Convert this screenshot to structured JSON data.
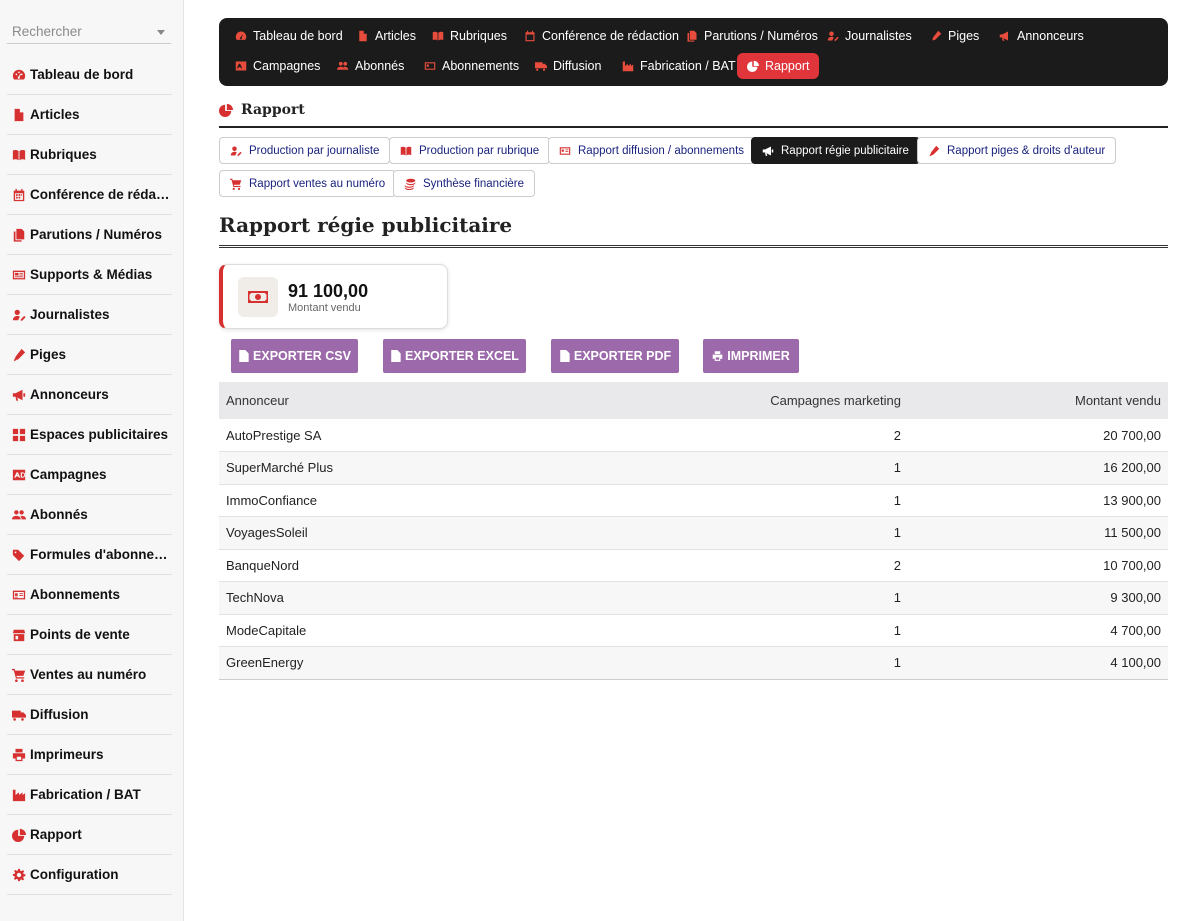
{
  "sidebar": {
    "search_placeholder": "Rechercher",
    "items": [
      {
        "label": "Tableau de bord",
        "icon": "gauge-icon"
      },
      {
        "label": "Articles",
        "icon": "file-icon"
      },
      {
        "label": "Rubriques",
        "icon": "book-icon"
      },
      {
        "label": "Conférence de rédac…",
        "icon": "calendar-icon"
      },
      {
        "label": "Parutions / Numéros",
        "icon": "copy-icon"
      },
      {
        "label": "Supports & Médias",
        "icon": "newspaper-icon"
      },
      {
        "label": "Journalistes",
        "icon": "user-pen-icon"
      },
      {
        "label": "Piges",
        "icon": "pen-icon"
      },
      {
        "label": "Annonceurs",
        "icon": "bullhorn-icon"
      },
      {
        "label": "Espaces publicitaires",
        "icon": "grid-icon"
      },
      {
        "label": "Campagnes",
        "icon": "ad-icon"
      },
      {
        "label": "Abonnés",
        "icon": "users-icon"
      },
      {
        "label": "Formules d'abonne…",
        "icon": "tags-icon"
      },
      {
        "label": "Abonnements",
        "icon": "id-card-icon"
      },
      {
        "label": "Points de vente",
        "icon": "store-icon"
      },
      {
        "label": "Ventes au numéro",
        "icon": "cart-icon"
      },
      {
        "label": "Diffusion",
        "icon": "truck-icon"
      },
      {
        "label": "Imprimeurs",
        "icon": "print-icon"
      },
      {
        "label": "Fabrication / BAT",
        "icon": "industry-icon"
      },
      {
        "label": "Rapport",
        "icon": "pie-chart-icon"
      },
      {
        "label": "Configuration",
        "icon": "cog-icon"
      }
    ]
  },
  "topnav": {
    "items": [
      {
        "label": "Tableau de bord"
      },
      {
        "label": "Articles"
      },
      {
        "label": "Rubriques"
      },
      {
        "label": "Conférence de rédaction"
      },
      {
        "label": "Parutions / Numéros"
      },
      {
        "label": "Journalistes"
      },
      {
        "label": "Piges"
      },
      {
        "label": "Annonceurs"
      },
      {
        "label": "Campagnes"
      },
      {
        "label": "Abonnés"
      },
      {
        "label": "Abonnements"
      },
      {
        "label": "Diffusion"
      },
      {
        "label": "Fabrication / BAT"
      },
      {
        "label": "Rapport"
      }
    ],
    "active": "Rapport"
  },
  "section": {
    "title": "Rapport"
  },
  "report_tabs": [
    {
      "label": "Production par journaliste"
    },
    {
      "label": "Production par rubrique"
    },
    {
      "label": "Rapport diffusion / abonnements"
    },
    {
      "label": "Rapport régie publicitaire"
    },
    {
      "label": "Rapport piges & droits d'auteur"
    },
    {
      "label": "Rapport ventes au numéro"
    },
    {
      "label": "Synthèse financière"
    }
  ],
  "page_title": "Rapport régie publicitaire",
  "kpi": {
    "value": "91 100,00",
    "label": "Montant vendu"
  },
  "export": {
    "csv": "EXPORTER CSV",
    "excel": "EXPORTER EXCEL",
    "pdf": "EXPORTER PDF",
    "print": "IMPRIMER"
  },
  "table": {
    "headers": [
      "Annonceur",
      "Campagnes marketing",
      "Montant vendu"
    ],
    "rows": [
      [
        "AutoPrestige SA",
        "2",
        "20 700,00"
      ],
      [
        "SuperMarché Plus",
        "1",
        "16 200,00"
      ],
      [
        "ImmoConfiance",
        "1",
        "13 900,00"
      ],
      [
        "VoyagesSoleil",
        "1",
        "11 500,00"
      ],
      [
        "BanqueNord",
        "2",
        "10 700,00"
      ],
      [
        "TechNova",
        "1",
        "9 300,00"
      ],
      [
        "ModeCapitale",
        "1",
        "4 700,00"
      ],
      [
        "GreenEnergy",
        "1",
        "4 100,00"
      ]
    ]
  },
  "colors": {
    "accent": "#d63031",
    "nav_bg": "#1b1b1b",
    "export_btn": "#9c6aaa"
  }
}
